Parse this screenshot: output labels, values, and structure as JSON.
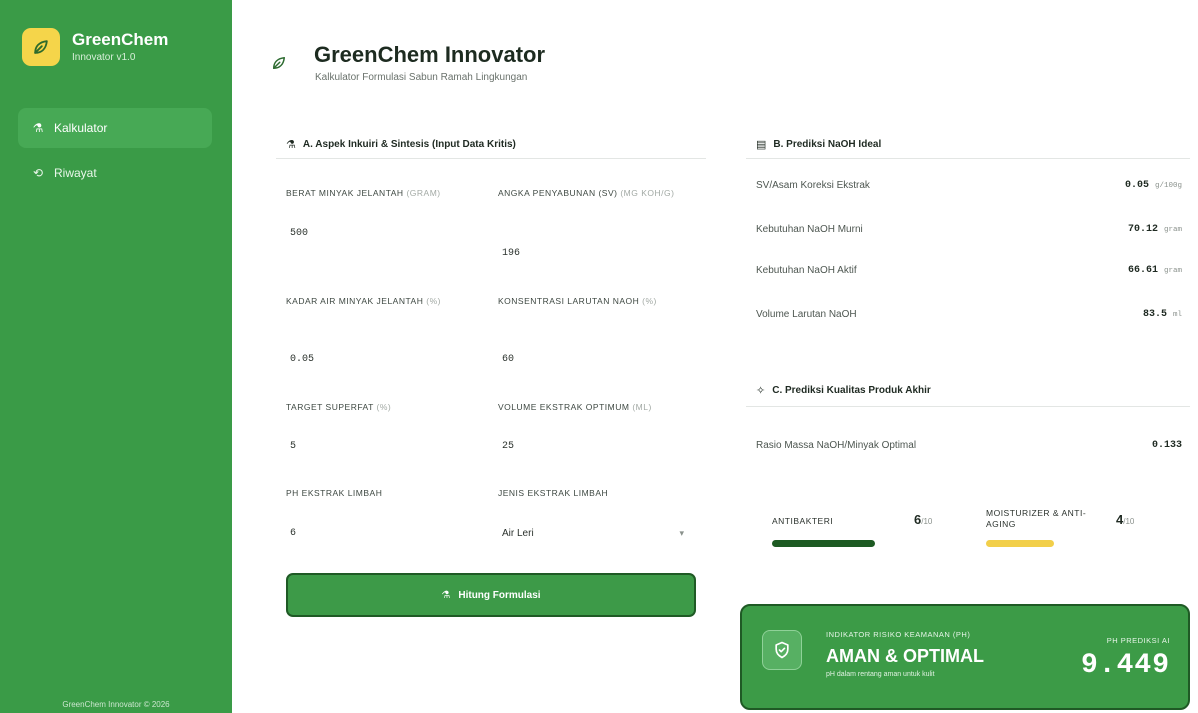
{
  "brand": {
    "name": "GreenChem",
    "version": "Innovator v1.0"
  },
  "sidebar": {
    "items": [
      {
        "label": "Kalkulator",
        "icon": "flask-icon"
      },
      {
        "label": "Riwayat",
        "icon": "history-icon"
      }
    ],
    "footer": "GreenChem Innovator © 2026"
  },
  "header": {
    "title": "GreenChem Innovator",
    "subtitle": "Kalkulator Formulasi Sabun Ramah Lingkungan"
  },
  "section_a": {
    "title": "A. Aspek Inkuiri & Sintesis (Input Data Kritis)",
    "fields": [
      {
        "label": "Berat Minyak Jelantah",
        "unit": "(Gram)",
        "value": "500"
      },
      {
        "label": "Angka Penyabunan (SV)",
        "unit": "(mg KOH/g)",
        "value": "196"
      },
      {
        "label": "Kadar Air Minyak Jelantah",
        "unit": "(%)",
        "value": "0.05"
      },
      {
        "label": "Konsentrasi Larutan NaOH",
        "unit": "(%)",
        "value": "60"
      },
      {
        "label": "Target Superfat",
        "unit": "(%)",
        "value": "5"
      },
      {
        "label": "Volume Ekstrak Optimum",
        "unit": "(mL)",
        "value": "25"
      },
      {
        "label": "pH Ekstrak Limbah",
        "unit": "",
        "value": "6"
      },
      {
        "label": "Jenis Ekstrak Limbah",
        "unit": "",
        "value": "Air Leri"
      }
    ],
    "button": "Hitung Formulasi"
  },
  "section_b": {
    "title": "B. Prediksi NaOH Ideal",
    "rows": [
      {
        "label": "SV/Asam Koreksi Ekstrak",
        "value": "0.05",
        "unit": "g/100g"
      },
      {
        "label": "Kebutuhan NaOH Murni",
        "value": "70.12",
        "unit": "gram"
      },
      {
        "label": "Kebutuhan NaOH Aktif",
        "value": "66.61",
        "unit": "gram"
      },
      {
        "label": "Volume Larutan NaOH",
        "value": "83.5",
        "unit": "ml"
      }
    ]
  },
  "section_c": {
    "title": "C. Prediksi Kualitas Produk Akhir",
    "ratio": {
      "label": "Rasio Massa NaOH/Minyak Optimal",
      "value": "0.133"
    },
    "scores": [
      {
        "label": "Antibakteri",
        "value": "6",
        "max": "/10",
        "fraction": 0.6,
        "color": "#1d5a22"
      },
      {
        "label": "Moisturizer & Anti-Aging",
        "value": "4",
        "max": "/10",
        "fraction": 0.4,
        "color": "#f2cf4a"
      }
    ]
  },
  "safety": {
    "label": "INDIKATOR RISIKO KEAMANAN (PH)",
    "status": "AMAN & OPTIMAL",
    "note": "pH dalam rentang aman untuk kulit",
    "ph_label": "PH PREDIKSI AI",
    "ph_value": "9.449"
  },
  "colors": {
    "sidebar": "#3a9b47",
    "accent_dark": "#1f5a25",
    "yellow": "#f5d54a"
  }
}
